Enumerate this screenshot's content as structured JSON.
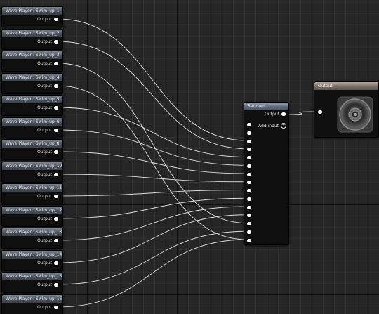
{
  "graph": {
    "wave_players": [
      {
        "title": "Wave Player : Swim_up_1",
        "output_label": "Output"
      },
      {
        "title": "Wave Player : Swim_up_2",
        "output_label": "Output"
      },
      {
        "title": "Wave Player : Swim_up_3",
        "output_label": "Output"
      },
      {
        "title": "Wave Player : Swim_up_4",
        "output_label": "Output"
      },
      {
        "title": "Wave Player : Swim_up_5",
        "output_label": "Output"
      },
      {
        "title": "Wave Player : Swim_up_6",
        "output_label": "Output"
      },
      {
        "title": "Wave Player : Swim_up_8",
        "output_label": "Output"
      },
      {
        "title": "Wave Player : Swim_up_10",
        "output_label": "Output"
      },
      {
        "title": "Wave Player : Swim_up_11",
        "output_label": "Output"
      },
      {
        "title": "Wave Player : Swim_up_12",
        "output_label": "Output"
      },
      {
        "title": "Wave Player : Swim_up_13",
        "output_label": "Output"
      },
      {
        "title": "Wave Player : Swim_up_14",
        "output_label": "Output"
      },
      {
        "title": "Wave Player : Swim_up_15",
        "output_label": "Output"
      },
      {
        "title": "Wave Player : Swim_up_16",
        "output_label": "Output"
      }
    ],
    "random_node": {
      "title": "Random",
      "output_label": "Output",
      "add_input_label": "Add input",
      "input_count": 15
    },
    "output_node": {
      "title": "Output",
      "icon": "speaker-icon"
    },
    "wire_targets": [
      2,
      3,
      12,
      14,
      4,
      5,
      6,
      7,
      8,
      9,
      10,
      11,
      13,
      14
    ]
  }
}
